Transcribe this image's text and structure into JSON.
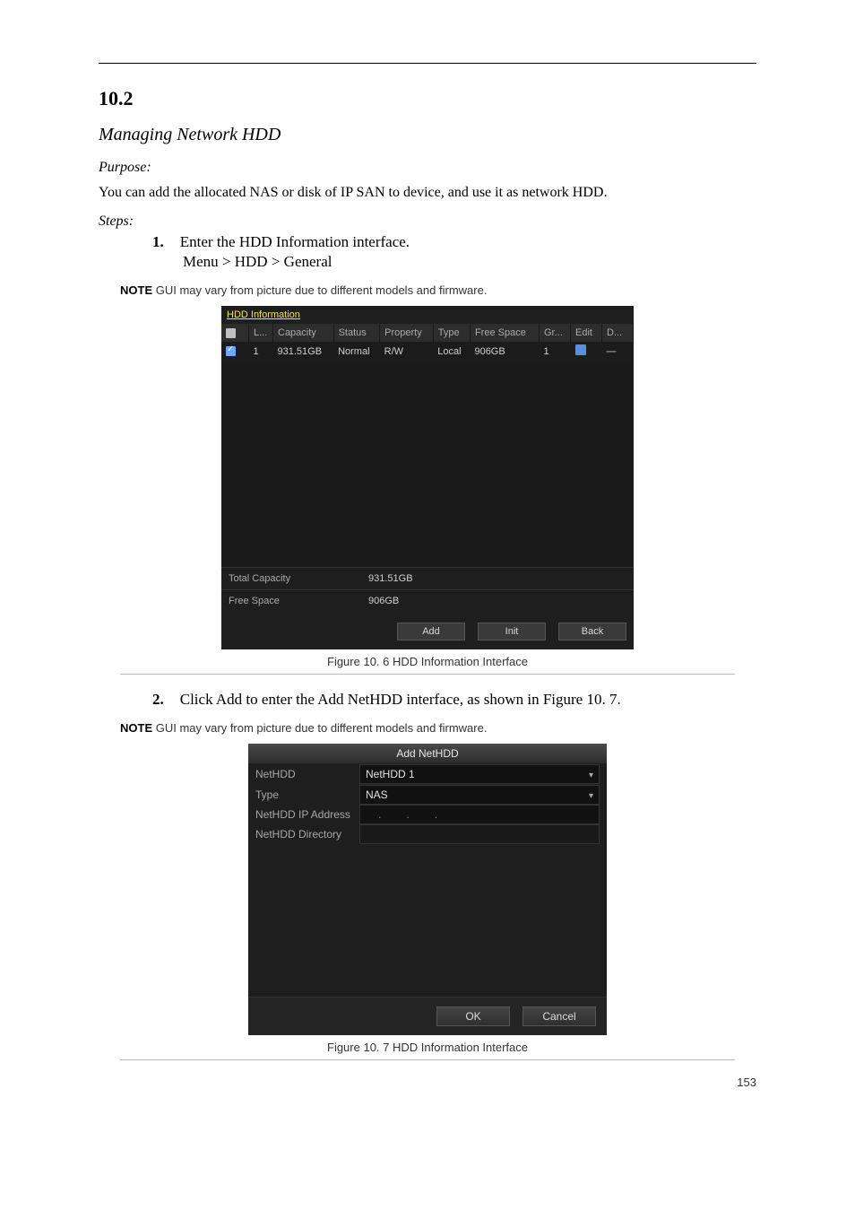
{
  "page_number": "153",
  "section": {
    "number": "10.2",
    "title": "Managing Network HDD",
    "purpose_h": "Purpose:",
    "purpose": "You can add the allocated NAS or disk of IP SAN to device, and use it as network HDD.",
    "steps_h": "Steps:",
    "steps": [
      "Enter the HDD Information interface.",
      "Click Add to enter the Add NetHDD interface, as shown in Figure 10. 7."
    ],
    "menu_path": "Menu > HDD > General"
  },
  "note1": {
    "label": "NOTE",
    "text": "GUI may vary from picture due to different models and firmware."
  },
  "note2": {
    "label": "NOTE",
    "text": "GUI may vary from picture due to different models and firmware."
  },
  "fig1": {
    "caption": "Figure 10. 6 HDD Information Interface",
    "tab": "HDD Information",
    "headers": {
      "l": "L...",
      "capacity": "Capacity",
      "status": "Status",
      "property": "Property",
      "type": "Type",
      "free": "Free Space",
      "gr": "Gr...",
      "edit": "Edit",
      "d": "D..."
    },
    "row": {
      "l": "1",
      "capacity": "931.51GB",
      "status": "Normal",
      "property": "R/W",
      "type": "Local",
      "free": "906GB",
      "gr": "1"
    },
    "totals": {
      "total_l": "Total Capacity",
      "total_v": "931.51GB",
      "free_l": "Free Space",
      "free_v": "906GB"
    },
    "buttons": {
      "add": "Add",
      "init": "Init",
      "back": "Back"
    }
  },
  "fig2": {
    "caption": "Figure 10. 7 HDD Information Interface",
    "title": "Add NetHDD",
    "rows": {
      "nethdd_l": "NetHDD",
      "nethdd_v": "NetHDD 1",
      "type_l": "Type",
      "type_v": "NAS",
      "ip_l": "NetHDD IP Address",
      "dir_l": "NetHDD Directory"
    },
    "buttons": {
      "ok": "OK",
      "cancel": "Cancel"
    }
  }
}
